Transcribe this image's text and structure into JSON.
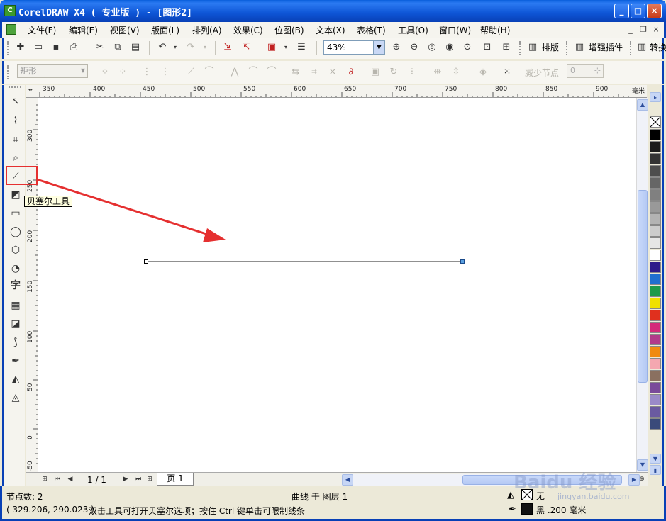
{
  "window": {
    "title": "CorelDRAW X4 ( 专业版 ) - [图形2]",
    "min_label": "_",
    "max_label": "□",
    "close_label": "×"
  },
  "menu": {
    "items": [
      "文件(F)",
      "编辑(E)",
      "视图(V)",
      "版面(L)",
      "排列(A)",
      "效果(C)",
      "位图(B)",
      "文本(X)",
      "表格(T)",
      "工具(O)",
      "窗口(W)",
      "帮助(H)"
    ]
  },
  "standard_toolbar": {
    "zoom_value": "43%",
    "layout_label": "排版",
    "plugin_label": "增强插件",
    "convert_label": "转换"
  },
  "property_bar": {
    "shape_label": "矩形",
    "reduce_nodes_label": "减少节点",
    "reduce_nodes_value": "0"
  },
  "rulers": {
    "unit": "毫米",
    "top_labels": [
      "350",
      "400",
      "450",
      "500",
      "550",
      "600",
      "650",
      "700",
      "750",
      "800",
      "850",
      "900"
    ],
    "left_labels": [
      "300",
      "250",
      "200",
      "150",
      "100",
      "50",
      "0",
      "-50"
    ]
  },
  "annotation": {
    "tooltip": "贝塞尔工具",
    "highlight_color": "#e53030"
  },
  "page_nav": {
    "count": "1 / 1",
    "tab": "页 1"
  },
  "status": {
    "node_count": "节点数: 2",
    "curve_layer": "曲线 于 图层 1",
    "coordinates": "( 329.206, 290.023 )",
    "hint": "双击工具可打开贝塞尔选项；按住 Ctrl 键单击可限制线条",
    "fill_label": "无",
    "outline_label": "黑  .200 毫米"
  },
  "palette_colors": [
    "#000000",
    "#1a1a1a",
    "#333333",
    "#4d4d4d",
    "#666666",
    "#808080",
    "#999999",
    "#b3b3b3",
    "#cccccc",
    "#e6e6e6",
    "#ffffff",
    "#2e1a8a",
    "#1f6fcf",
    "#1d9a4a",
    "#f0e000",
    "#e0301e",
    "#d42a7a",
    "#b23a8a",
    "#f08a10",
    "#f4a7b0",
    "#8a7060",
    "#7a4a9a",
    "#9a8ac8",
    "#6a5aa0",
    "#3a4a7a"
  ],
  "watermark": {
    "main": "Baidu 经验",
    "sub": "jingyan.baidu.com"
  }
}
